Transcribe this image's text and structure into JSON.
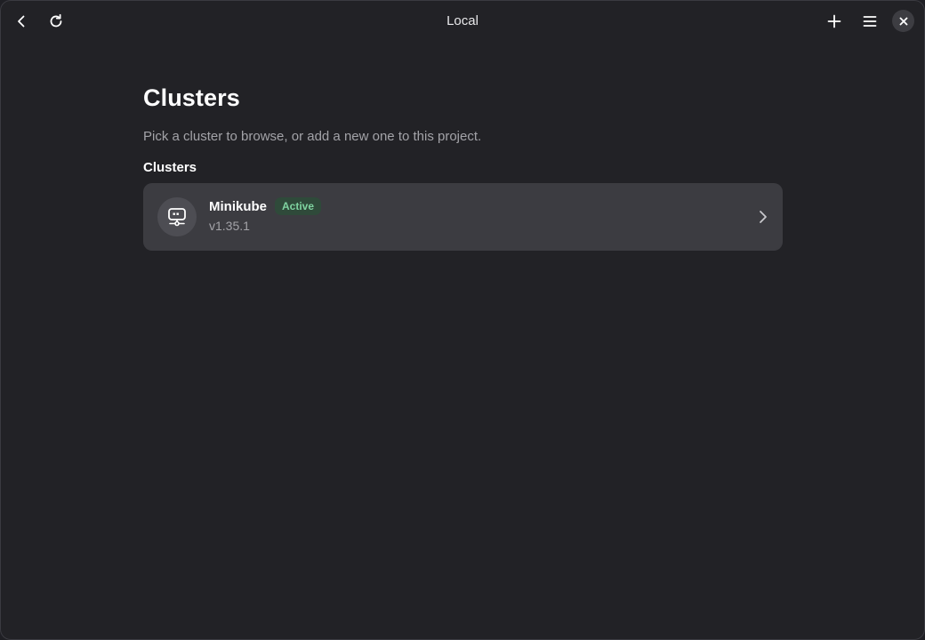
{
  "window": {
    "title": "Local"
  },
  "headerbar": {
    "back_icon": "go-back-icon",
    "refresh_icon": "refresh-icon",
    "add_icon": "add-icon",
    "menu_icon": "hamburger-menu-icon",
    "close_icon": "close-icon"
  },
  "page": {
    "title": "Clusters",
    "subtitle": "Pick a cluster to browse, or add a new one to this project.",
    "section_title": "Clusters"
  },
  "clusters": [
    {
      "name": "Minikube",
      "status": "Active",
      "version": "v1.35.1",
      "icon": "cluster-node-icon"
    }
  ],
  "colors": {
    "background": "#222226",
    "row": "#3c3c41",
    "badge_bg": "#2f4a3a",
    "badge_text": "#7fd3a0",
    "muted_text": "#a3a3a8"
  }
}
